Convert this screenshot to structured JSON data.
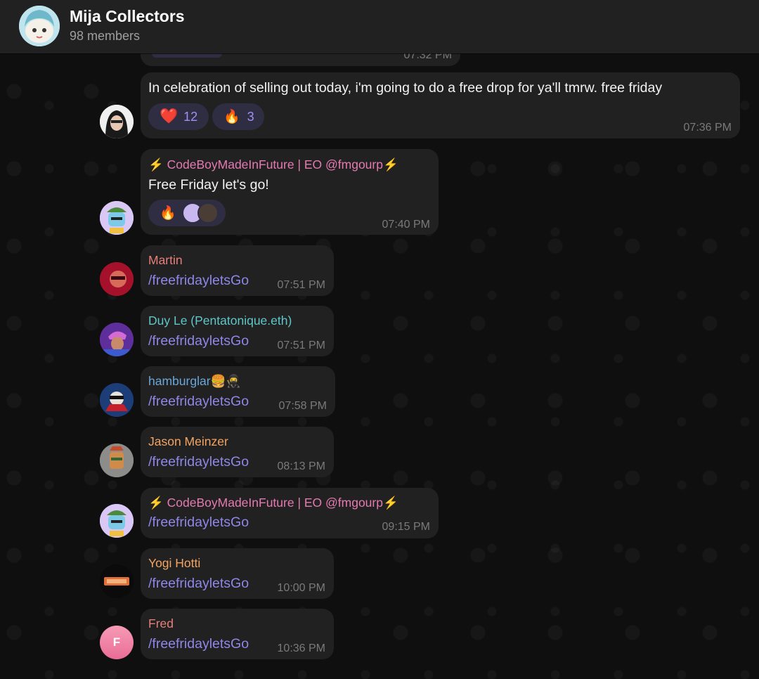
{
  "chat": {
    "title": "Mija Collectors",
    "subtitle": "98 members"
  },
  "messages": {
    "prev": {
      "time": "07:32 PM"
    },
    "m1": {
      "text": "In celebration of selling out today, i'm going to do a free drop for ya'll tmrw. free friday",
      "time": "07:36 PM",
      "reactions": [
        {
          "emoji": "❤️",
          "count": "12"
        },
        {
          "emoji": "🔥",
          "count": "3"
        }
      ]
    },
    "m2": {
      "author": "⚡️ CodeBoyMadeInFuture | EO @fmgourp⚡️",
      "text": "Free Friday let's go!",
      "time": "07:40 PM",
      "reaction_emoji": "🔥"
    },
    "m3": {
      "author": "Martin",
      "text": "/freefridayletsGo",
      "time": "07:51 PM"
    },
    "m4": {
      "author": "Duy Le (Pentatonique.eth)",
      "text": "/freefridayletsGo",
      "time": "07:51 PM"
    },
    "m5": {
      "author": "hamburglar🍔🥷",
      "text": "/freefridayletsGo",
      "time": "07:58 PM"
    },
    "m6": {
      "author": "Jason Meinzer",
      "text": "/freefridayletsGo",
      "time": "08:13 PM"
    },
    "m7": {
      "author": "⚡️ CodeBoyMadeInFuture | EO @fmgourp⚡️",
      "text": "/freefridayletsGo",
      "time": "09:15 PM"
    },
    "m8": {
      "author": "Yogi Hotti",
      "text": "/freefridayletsGo",
      "time": "10:00 PM"
    },
    "m9": {
      "author": "Fred",
      "avatar_initial": "F",
      "text": "/freefridayletsGo",
      "time": "10:36 PM"
    }
  },
  "colors": {
    "accent": "#8f86e8",
    "bubble": "#212121",
    "header": "#212121",
    "martin": "#e67f7a",
    "duy": "#5fc7c9",
    "hamburglar": "#6aa6d8",
    "jason": "#f3a464",
    "codeboy": "#e57ab2",
    "yogi": "#f3a464",
    "fred": "#e67f7a"
  }
}
